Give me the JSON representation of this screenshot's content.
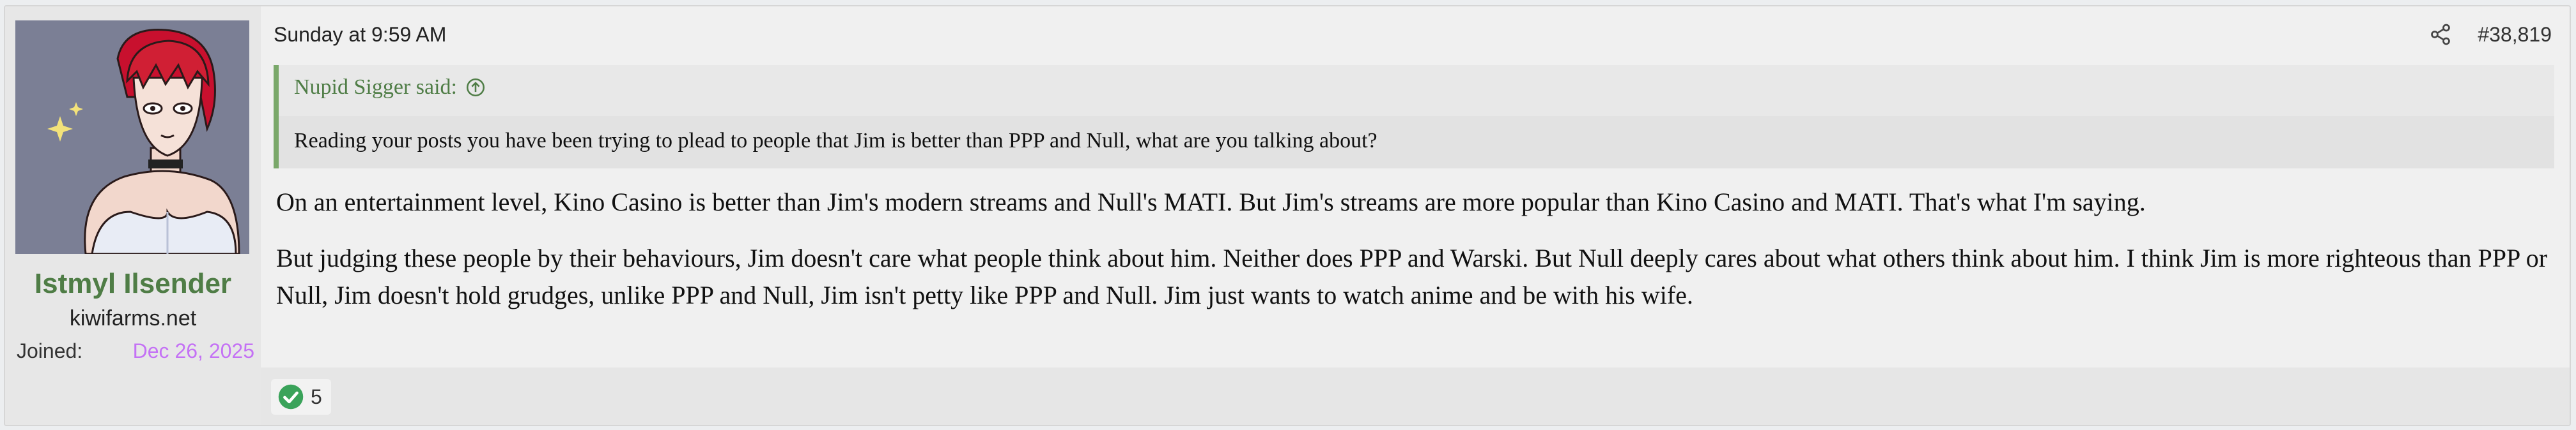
{
  "user": {
    "name": "Istmyl Ilsender",
    "title": "kiwifarms.net",
    "joined_label": "Joined:",
    "joined_date": "Dec 26, 2025",
    "avatar_icon": "anime-avatar"
  },
  "post": {
    "timestamp": "Sunday at 9:59 AM",
    "share_icon": "share-icon",
    "number": "#38,819",
    "quote": {
      "author_said": "Nupid Sigger said:",
      "expand_icon": "arrow-up-circle-icon",
      "text": "Reading your posts you have been trying to plead to people that Jim is better than PPP and Null, what are you talking about?"
    },
    "paragraphs": [
      "On an entertainment level, Kino Casino is better than Jim's modern streams and Null's MATI. But Jim's streams are more popular than Kino Casino and MATI. That's what I'm saying.",
      "But judging these people by their behaviours, Jim doesn't care what people think about him. Neither does PPP and Warski. But Null deeply cares about what others think about him. I think Jim is more righteous than PPP or Null, Jim doesn't hold grudges, unlike PPP and Null, Jim isn't petty like PPP and Null. Jim just wants to watch anime and be with his wife."
    ],
    "reactions": {
      "icon": "checkmark-icon",
      "count": "5"
    }
  },
  "colors": {
    "username": "#4f7d46",
    "quote_border": "#7aa86a",
    "joined_date": "#c471f5",
    "reaction_check": "#3aa35a"
  }
}
